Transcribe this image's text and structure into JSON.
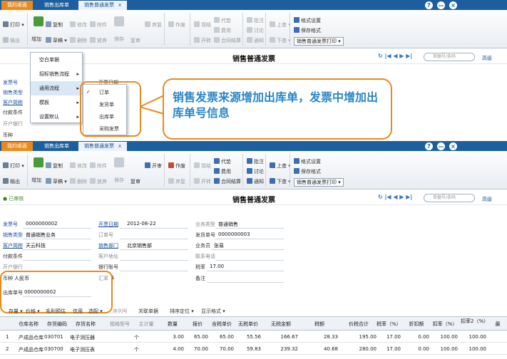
{
  "top": {
    "tabs": [
      {
        "label": "我的桌面"
      },
      {
        "label": "销售出库单"
      },
      {
        "label": "销售普通发票"
      }
    ],
    "tab_close": "x",
    "window_buttons": [
      "?",
      "—",
      "×"
    ],
    "toolbar": {
      "print": "打印",
      "output": "输出",
      "add": "增加",
      "copy": "复制",
      "draft": "草稿",
      "modify": "修改",
      "delete": "删除",
      "attach": "附件",
      "abandon": "放弃",
      "save": "保存",
      "review": "复审",
      "void": "作废",
      "cancel_void": "弃复",
      "cash": "现结",
      "pay_cost": "代垫",
      "fee": "费用",
      "open_bill": "开转",
      "combine": "合同结算",
      "approve": "批注",
      "discuss": "讨论",
      "notify": "通知",
      "up": "上查",
      "down": "下查",
      "fmt_set": "格式设置",
      "save_fmt": "保存格式",
      "print_select": "销售普通发票打印"
    },
    "doc_title": "销售普通发票",
    "search_placeholder": "单据号/条码",
    "advanced": "高级",
    "form": {
      "invoice_no_label": "发票号",
      "sale_type_label": "销售类型",
      "customer_label": "客户简称",
      "pay_terms_label": "付款条件",
      "bank_label": "开户银行",
      "currency_label": "币种",
      "open_date_label": "开票日期"
    },
    "menu": {
      "items": [
        {
          "label": "空白单据"
        },
        {
          "label": "招标销售流程",
          "arrow": "▸"
        },
        {
          "label": "通用流程",
          "arrow": "▸"
        },
        {
          "label": "模板",
          "arrow": "▸"
        },
        {
          "label": "设置默认",
          "arrow": "▸"
        }
      ],
      "submenu": [
        "订单",
        "发货单",
        "出库单",
        "采购发票"
      ],
      "check": "✓"
    },
    "callout": "销售发票来源增加出库单，发票中增加出库单号信息"
  },
  "bottom": {
    "tabs": [
      {
        "label": "我的桌面"
      },
      {
        "label": "销售出库单"
      },
      {
        "label": "销售普通发票"
      }
    ],
    "toolbar": {
      "print": "打印",
      "output": "输出",
      "add": "增加",
      "copy": "复制",
      "draft": "草稿",
      "modify": "修改",
      "delete": "删除",
      "attach": "附件",
      "abandon": "放弃",
      "save": "保存",
      "review": "复审",
      "open": "开审",
      "void": "作废",
      "cancel_void": "弃复",
      "cash": "现结",
      "pay_cost": "代垫",
      "fee": "费用",
      "open_bill": "开转",
      "combine": "合同结算",
      "approve": "批注",
      "discuss": "讨论",
      "notify": "通知",
      "up": "上查",
      "down": "下查",
      "fmt_set": "格式设置",
      "save_fmt": "保存格式",
      "print_select": "销售普通发票打印"
    },
    "status": "已审核",
    "doc_title": "销售普通发票",
    "search_placeholder": "单据号/条码",
    "advanced": "高级",
    "form": {
      "invoice_no_label": "发票号",
      "invoice_no": "0000000002",
      "open_date_label": "开票日期",
      "open_date": "2012-08-22",
      "biz_type_label": "业务类型",
      "biz_type": "普通销售",
      "sale_type_label": "销售类型",
      "sale_type": "普通销售业务",
      "order_no_label": "订单号",
      "ship_no_label": "发货单号",
      "ship_no": "0000000003",
      "customer_label": "客户简称",
      "customer": "天云科技",
      "dept_label": "销售部门",
      "dept": "北京销售部",
      "salesman_label": "业务员",
      "salesman": "张易",
      "pay_terms_label": "付款条件",
      "cust_addr_label": "客户地址",
      "contact_label": "联系电话",
      "bank_label": "开户银行",
      "account_label": "银行账号",
      "tax_rate_label": "税率",
      "tax_rate": "17.00",
      "currency_label": "币种",
      "currency": "人民币",
      "exrate_label": "汇率",
      "exrate": "1",
      "remark_label": "备注",
      "outbound_no_label": "出库单号",
      "outbound_no": "0000000002"
    },
    "grid_toolbar": [
      "存量",
      "价格",
      "毛利预估",
      "信用",
      "选配",
      "序列号",
      "关联单据",
      "排序定位",
      "显示格式"
    ],
    "columns": [
      "仓库名称",
      "存货编码",
      "存货名称",
      "规格型号",
      "主计量",
      "数量",
      "报价",
      "含税单价",
      "无税单价",
      "无税金额",
      "税额",
      "价税合计",
      "税率（%）",
      "折扣额",
      "扣率（%）",
      "扣率2（%）",
      "最"
    ],
    "rows": [
      {
        "idx": "1",
        "wh": "产成品仓库",
        "code": "030701",
        "name": "电子测压器",
        "spec": "",
        "unit": "个",
        "qty": "3.00",
        "quote": "65.00",
        "tax_price": "65.00",
        "price": "55.56",
        "amount": "166.67",
        "tax": "28.33",
        "total": "195.00",
        "rate": "17.00",
        "disc": "0.00",
        "d1": "100.00",
        "d2": "100.00"
      },
      {
        "idx": "2",
        "wh": "产成品仓库",
        "code": "030700",
        "name": "电子测压表",
        "spec": "",
        "unit": "个",
        "qty": "4.00",
        "quote": "70.00",
        "tax_price": "70.00",
        "price": "59.83",
        "amount": "239.32",
        "tax": "40.68",
        "total": "280.00",
        "rate": "17.00",
        "disc": "0.00",
        "d1": "100.00",
        "d2": "100.00"
      }
    ]
  },
  "colors": {
    "header_blue": "#1d5f9e",
    "accent_orange": "#e98a1e",
    "link_blue": "#1d4f9e"
  }
}
